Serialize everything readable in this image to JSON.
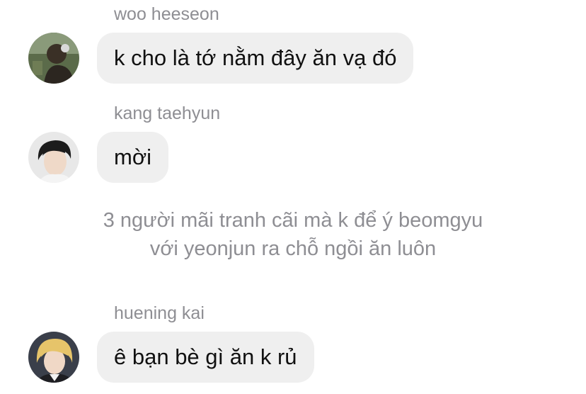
{
  "messages": [
    {
      "sender": "woo heeseon",
      "text": "k cho là tớ nằm đây ăn vạ đó",
      "avatar": "profile-photo"
    },
    {
      "sender": "kang taehyun",
      "text": "mời",
      "avatar": "profile-photo"
    },
    {
      "sender": "huening kai",
      "text": "ê bạn bè gì ăn k rủ",
      "avatar": "profile-photo"
    }
  ],
  "system_note": {
    "line1": "3 người mãi tranh cãi mà k để ý beomgyu",
    "line2": "với yeonjun ra chỗ ngồi ăn luôn"
  },
  "colors": {
    "bubble": "#efefef",
    "sender_name": "#8e8e93",
    "message_text": "#111111",
    "note_text": "#8e8e93"
  }
}
